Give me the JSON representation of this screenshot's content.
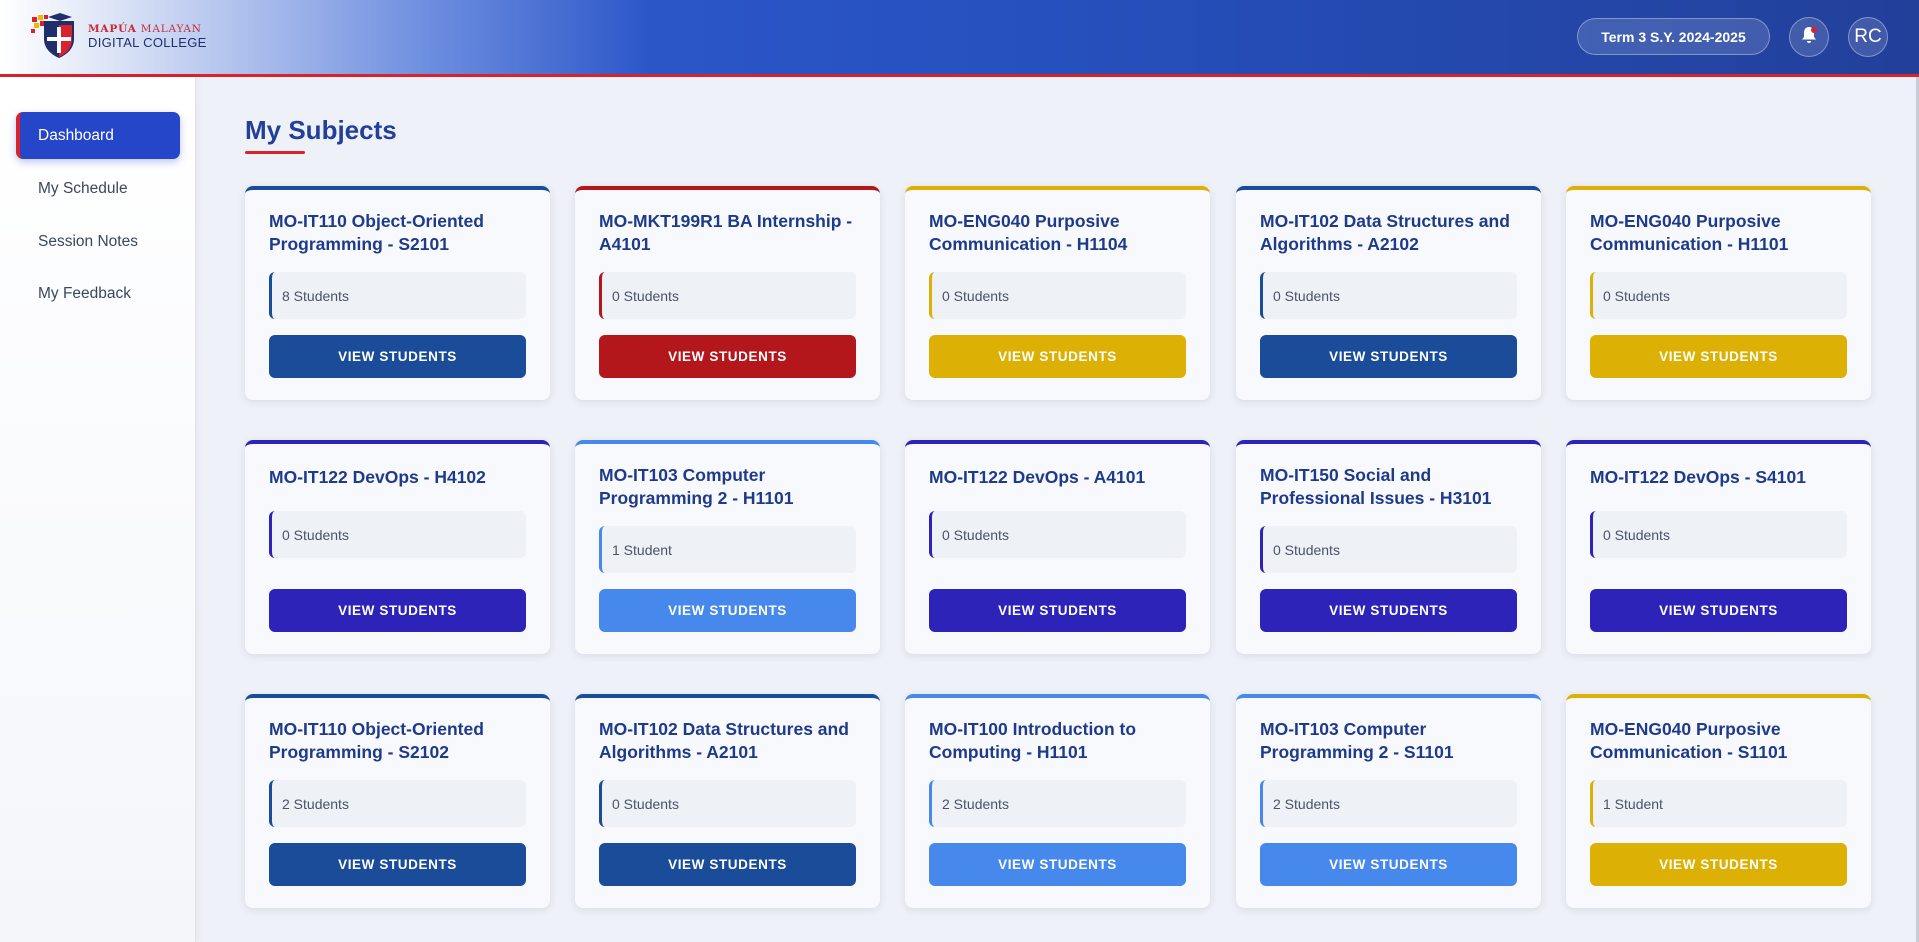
{
  "header": {
    "logo_line1_a": "MAPÚA",
    "logo_line1_b": "MALAYAN",
    "logo_line2": "DIGITAL COLLEGE",
    "term": "Term 3 S.Y. 2024-2025",
    "avatar_initials": "RC"
  },
  "sidebar": {
    "items": [
      {
        "label": "Dashboard",
        "active": true
      },
      {
        "label": "My Schedule",
        "active": false
      },
      {
        "label": "Session Notes",
        "active": false
      },
      {
        "label": "My Feedback",
        "active": false
      }
    ]
  },
  "main": {
    "title": "My Subjects",
    "button_label": "VIEW STUDENTS"
  },
  "colors": {
    "navy": "#1a4c9a",
    "red": "#b3161b",
    "gold": "#dcb004",
    "indigo": "#2d23b8",
    "sky": "#4688eb"
  },
  "subjects": [
    {
      "title": "MO-IT110 Object-Oriented Programming - S2101",
      "students": "8 Students",
      "color": "#1a4c9a"
    },
    {
      "title": "MO-MKT199R1 BA Internship - A4101",
      "students": "0 Students",
      "color": "#b3161b"
    },
    {
      "title": "MO-ENG040 Purposive Communication - H1104",
      "students": "0 Students",
      "color": "#dcb004"
    },
    {
      "title": "MO-IT102 Data Structures and Algorithms - A2102",
      "students": "0 Students",
      "color": "#1a4c9a"
    },
    {
      "title": "MO-ENG040 Purposive Communication - H1101",
      "students": "0 Students",
      "color": "#dcb004"
    },
    {
      "title": "MO-IT122 DevOps - H4102",
      "students": "0 Students",
      "color": "#2d23b8"
    },
    {
      "title": "MO-IT103 Computer Programming 2 - H1101",
      "students": "1 Student",
      "color": "#4688eb"
    },
    {
      "title": "MO-IT122 DevOps - A4101",
      "students": "0 Students",
      "color": "#2d23b8"
    },
    {
      "title": "MO-IT150 Social and Professional Issues - H3101",
      "students": "0 Students",
      "color": "#2d23b8"
    },
    {
      "title": "MO-IT122 DevOps - S4101",
      "students": "0 Students",
      "color": "#2d23b8"
    },
    {
      "title": "MO-IT110 Object-Oriented Programming - S2102",
      "students": "2 Students",
      "color": "#1a4c9a"
    },
    {
      "title": "MO-IT102 Data Structures and Algorithms - A2101",
      "students": "0 Students",
      "color": "#1a4c9a"
    },
    {
      "title": "MO-IT100 Introduction to Computing - H1101",
      "students": "2 Students",
      "color": "#4688eb"
    },
    {
      "title": "MO-IT103 Computer Programming 2 - S1101",
      "students": "2 Students",
      "color": "#4688eb"
    },
    {
      "title": "MO-ENG040 Purposive Communication - S1101",
      "students": "1 Student",
      "color": "#dcb004"
    }
  ]
}
